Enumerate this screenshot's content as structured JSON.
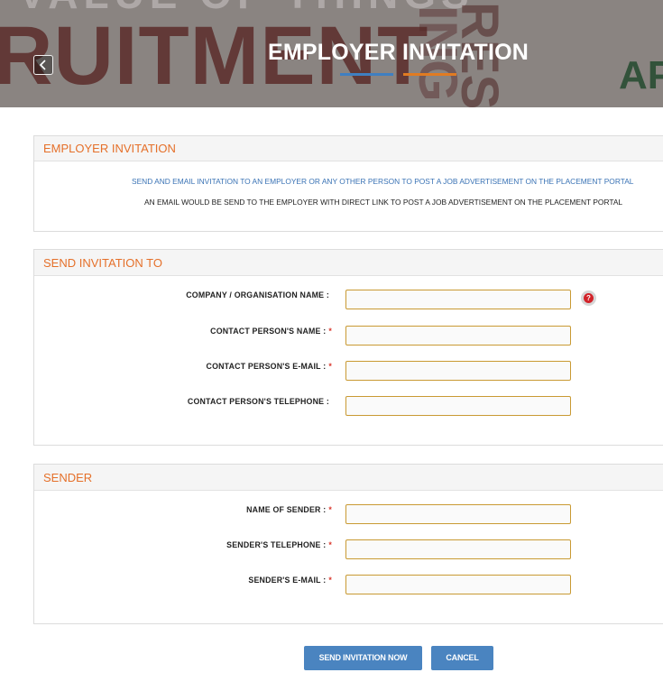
{
  "banner": {
    "title": "EMPLOYER INVITATION",
    "watermark_main": "RUITMENT",
    "watermark_top": "VALUE OF THINGS",
    "watermark_vertical_1": "ING",
    "watermark_vertical_2": "RES",
    "watermark_right": "AP",
    "back_icon": "chevron-left-icon"
  },
  "intro": {
    "heading": "EMPLOYER INVITATION",
    "line1": "SEND AND EMAIL INVITATION TO AN EMPLOYER OR ANY OTHER PERSON TO POST A JOB ADVERTISEMENT ON THE PLACEMENT PORTAL",
    "line2": "AN EMAIL WOULD BE SEND TO THE EMPLOYER WITH DIRECT LINK TO POST A JOB ADVERTISEMENT ON THE PLACEMENT PORTAL"
  },
  "send_to": {
    "heading": "SEND INVITATION TO",
    "fields": [
      {
        "label": "COMPANY / ORGANISATION NAME :",
        "required": "",
        "value": ""
      },
      {
        "label": "CONTACT PERSON'S NAME :",
        "required": "*",
        "value": ""
      },
      {
        "label": "CONTACT PERSON'S E-MAIL :",
        "required": "*",
        "value": ""
      },
      {
        "label": "CONTACT PERSON'S TELEPHONE :",
        "required": "",
        "value": ""
      }
    ],
    "help_glyph": "?"
  },
  "sender": {
    "heading": "SENDER",
    "fields": [
      {
        "label": "NAME OF SENDER :",
        "required": "*",
        "value": ""
      },
      {
        "label": "SENDER'S TELEPHONE :",
        "required": "*",
        "value": ""
      },
      {
        "label": "SENDER'S E-MAIL :",
        "required": "*",
        "value": ""
      }
    ]
  },
  "buttons": {
    "send": "SEND INVITATION NOW",
    "cancel": "CANCEL"
  },
  "colors": {
    "accent_orange": "#e5702a",
    "accent_blue": "#4a84c0",
    "required_red": "#d9362b",
    "input_border": "#c99a33"
  }
}
